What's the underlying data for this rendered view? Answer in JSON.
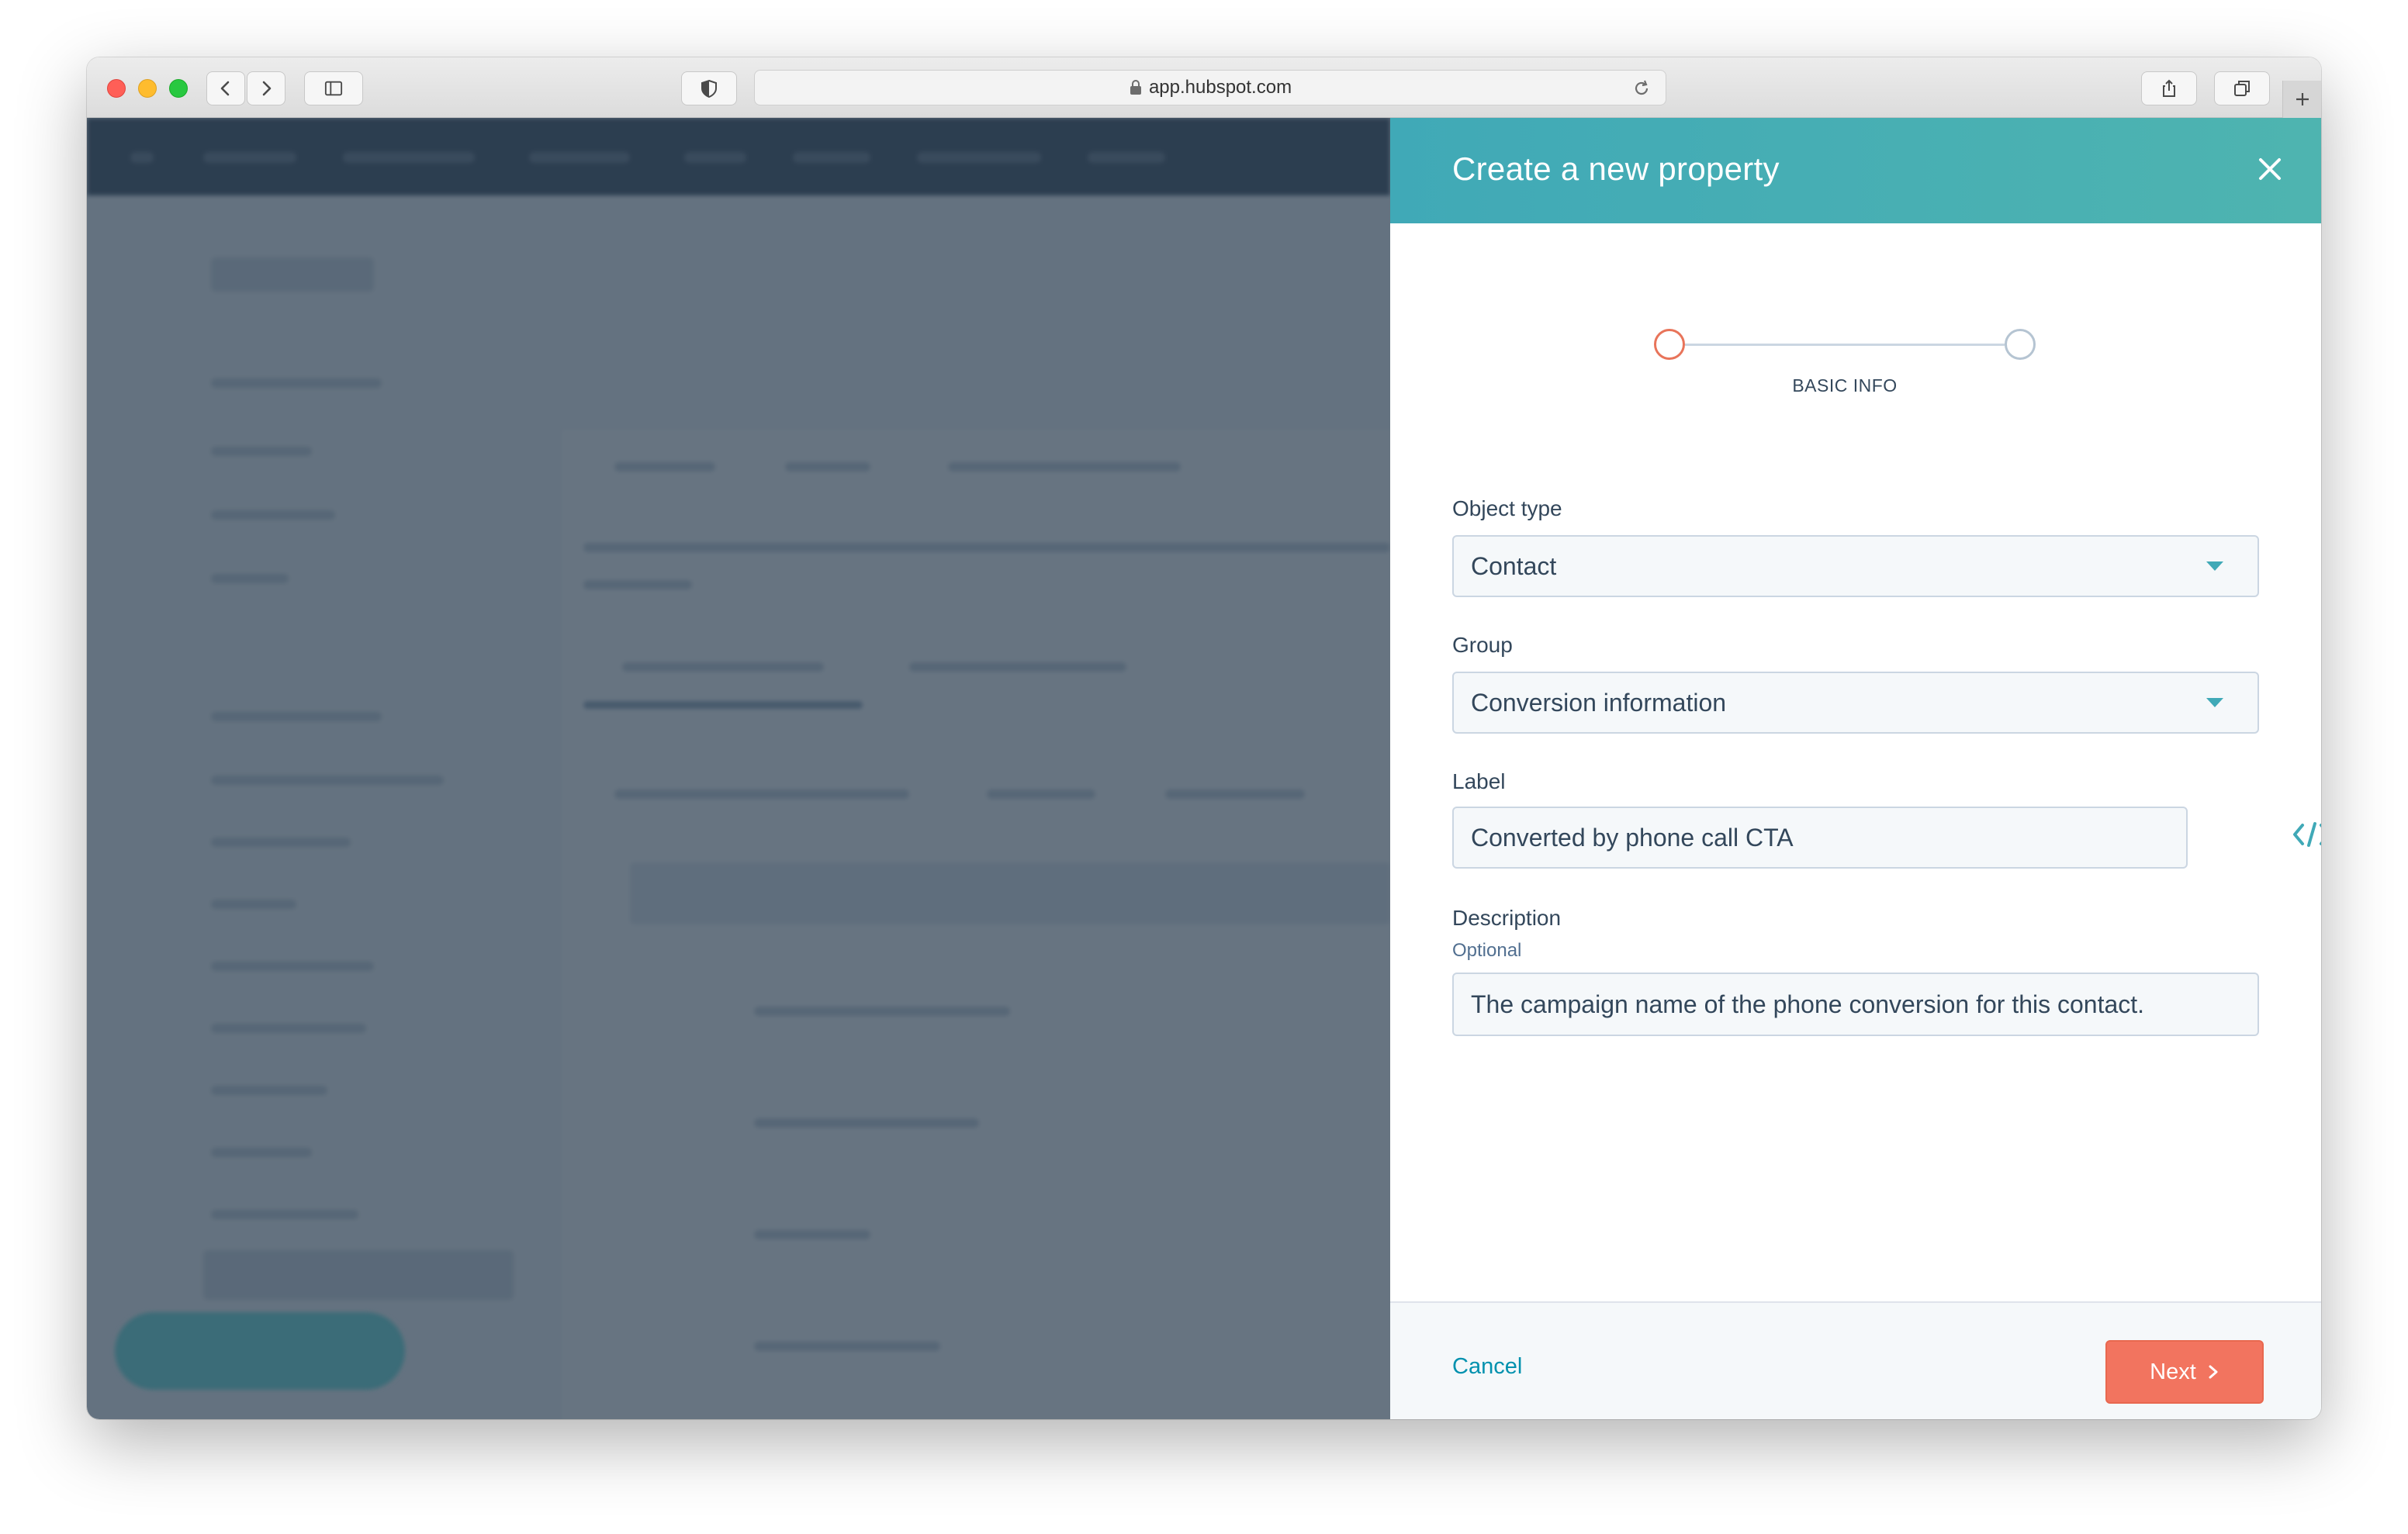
{
  "browser": {
    "url": "app.hubspot.com"
  },
  "panel": {
    "title": "Create a new property",
    "step_label": "BASIC INFO",
    "object_type": {
      "label": "Object type",
      "value": "Contact"
    },
    "group": {
      "label": "Group",
      "value": "Conversion information"
    },
    "label_field": {
      "label": "Label",
      "value": "Converted by phone call CTA"
    },
    "description": {
      "label": "Description",
      "optional_text": "Optional",
      "value": "The campaign name of the phone conversion for this contact."
    },
    "cancel_label": "Cancel",
    "next_label": "Next"
  },
  "colors": {
    "header_teal": "#40a9b7",
    "accent_orange": "#f2745f",
    "link_blue": "#0091ae",
    "text_dark": "#33475b"
  },
  "icons": {
    "close": "close-icon",
    "code": "code-icon",
    "next": "chevron-right-icon",
    "caret": "caret-down-icon"
  }
}
